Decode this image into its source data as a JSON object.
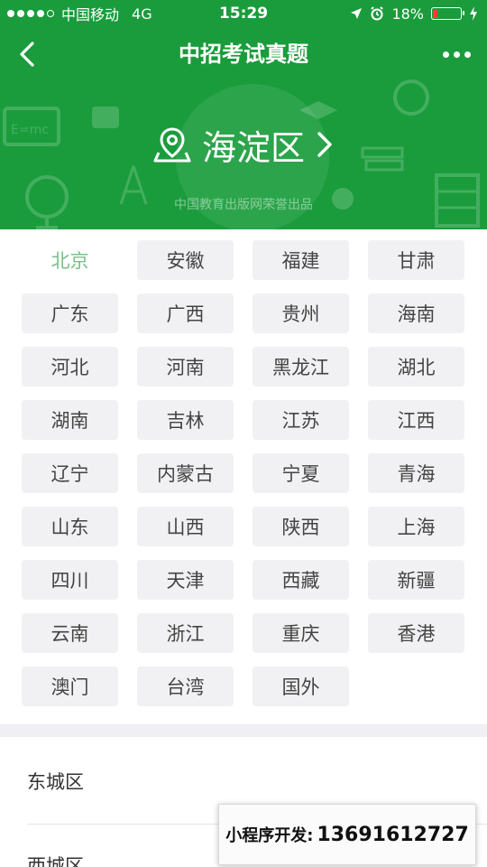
{
  "status_bar": {
    "carrier": "中国移动",
    "network": "4G",
    "time": "15:29",
    "battery_percent": "18%",
    "battery_level": 0.18,
    "icons": [
      "location-arrow-icon",
      "alarm-icon",
      "charging-icon"
    ]
  },
  "nav": {
    "title": "中招考试真题",
    "back_icon": "chevron-left-icon",
    "more_icon": "more-dots-icon"
  },
  "header": {
    "region": "海淀区",
    "region_icon": "map-pin-icon",
    "publisher": "中国教育出版网荣誉出品"
  },
  "provinces": [
    "北京",
    "安徽",
    "福建",
    "甘肃",
    "广东",
    "广西",
    "贵州",
    "海南",
    "河北",
    "河南",
    "黑龙江",
    "湖北",
    "湖南",
    "吉林",
    "江苏",
    "江西",
    "辽宁",
    "内蒙古",
    "宁夏",
    "青海",
    "山东",
    "山西",
    "陕西",
    "上海",
    "四川",
    "天津",
    "西藏",
    "新疆",
    "云南",
    "浙江",
    "重庆",
    "香港",
    "澳门",
    "台湾",
    "国外"
  ],
  "selected_province": "北京",
  "districts": [
    "东城区",
    "西城区"
  ],
  "dev_banner": {
    "label": "小程序开发:",
    "phone": "13691612727"
  },
  "colors": {
    "brand_green": "#1a9c3c",
    "selected_text": "#7bbf8a",
    "chip_bg": "#f1f1f3",
    "battery_low": "#ff3b30"
  }
}
